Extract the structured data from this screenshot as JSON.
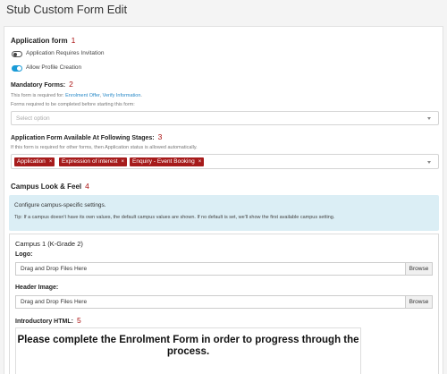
{
  "page": {
    "title": "Stub Custom Form Edit"
  },
  "application_form": {
    "heading": "Application form",
    "marker": "1",
    "toggles": [
      {
        "label": "Application Requires Invitation",
        "on": false
      },
      {
        "label": "Allow Profile Creation",
        "on": true
      }
    ]
  },
  "mandatory_forms": {
    "heading": "Mandatory Forms:",
    "marker": "2",
    "help_prefix": "This form is required for:",
    "help_link1": "Enrolment Offer",
    "help_sep": ",",
    "help_link2": "Verify Information",
    "help_suffix": ".",
    "help2": "Forms required to be completed before starting this form:",
    "placeholder": "Select option"
  },
  "stages": {
    "heading": "Application Form Available At Following Stages:",
    "marker": "3",
    "help": "If this form is required for other forms, then Application status is allowed automatically.",
    "tags": [
      "Application",
      "Expression of interest",
      "Enquiry - Event Booking"
    ],
    "remove_glyph": "×"
  },
  "campus_look": {
    "heading": "Campus Look & Feel",
    "marker": "4",
    "info_title": "Configure campus-specific settings.",
    "info_tip": "Tip: If a campus doesn't have its own values, the default campus values are shown. If no default is set, we'll show the first available campus setting."
  },
  "campus": {
    "title": "Campus 1 (K-Grade 2)",
    "logo_label": "Logo:",
    "header_label": "Header Image:",
    "drop_text": "Drag and Drop Files Here",
    "browse_label": "Browse",
    "intro_label": "Introductory HTML:",
    "intro_marker": "5",
    "intro_content": "Please complete the Enrolment Form in order to progress through the process."
  },
  "colors": {
    "accent": "#1a9bd7",
    "tag": "#a61b1b",
    "marker": "#aa1111",
    "info_bg": "#dbeef5"
  }
}
